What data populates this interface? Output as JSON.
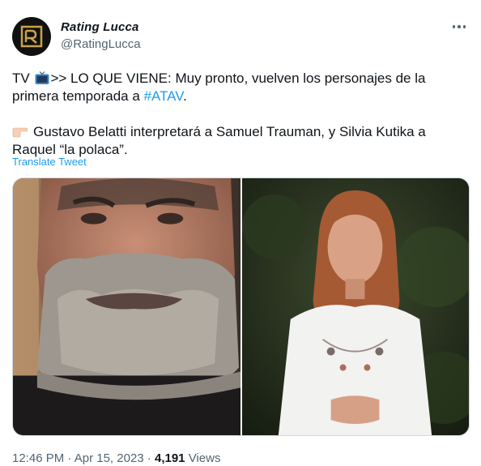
{
  "author": {
    "display_name": "Rating Lucca",
    "handle": "@RatingLucca",
    "avatar_icon": "rl-monogram-logo"
  },
  "tweet": {
    "line1_prefix": "TV ",
    "line1_icon": "television-emoji",
    "line1_rest": ">> LO QUE VIENE: Muy pronto, vuelven los personajes de la primera temporada a ",
    "hashtag": "#ATAV",
    "line1_end": ".",
    "line2_icon": "pointing-hand-emoji",
    "line2_text": "Gustavo Belatti interpretará a Samuel Trauman, y Silvia Kutika a Raquel “la polaca”.",
    "translate_label": "Translate Tweet"
  },
  "media": {
    "left_photo": "bearded-man-photo",
    "right_photo": "woman-white-blouse-photo"
  },
  "meta": {
    "time": "12:46 PM",
    "sep1": " · ",
    "date": "Apr 15, 2023",
    "sep2": " · ",
    "views_count": "4,191",
    "views_label": " Views"
  },
  "colors": {
    "link": "#1d9bf0",
    "secondary_text": "#536471",
    "primary_text": "#0f1419"
  }
}
